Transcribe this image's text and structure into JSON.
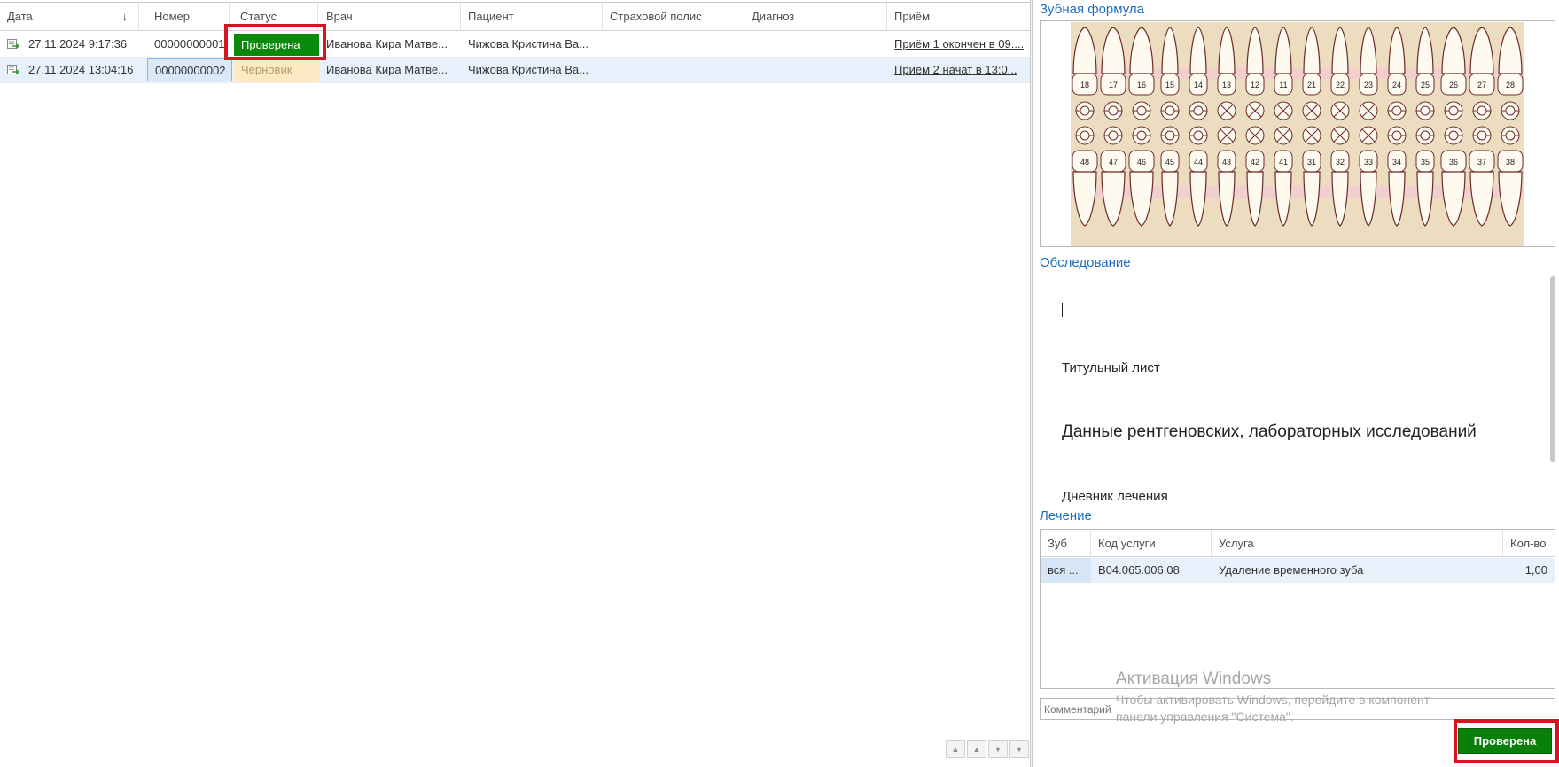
{
  "grid": {
    "columns": [
      "Дата",
      "Номер",
      "Статус",
      "Врач",
      "Пациент",
      "Страховой полис",
      "Диагноз",
      "Приём"
    ],
    "sort_indicator": "↓",
    "rows": [
      {
        "date": "27.11.2024 9:17:36",
        "number": "00000000001",
        "status": "Проверена",
        "doctor": "Иванова Кира Матве...",
        "patient": "Чижова Кристина Ва...",
        "policy": "",
        "diagnosis": "",
        "visit": "Приём 1 окончен в 09...."
      },
      {
        "date": "27.11.2024 13:04:16",
        "number": "00000000002",
        "status": "Черновик",
        "doctor": "Иванова Кира Матве...",
        "patient": "Чижова Кристина Ва...",
        "policy": "",
        "diagnosis": "",
        "visit": "Приём 2 начат в 13:0..."
      }
    ]
  },
  "right": {
    "dental_formula_title": "Зубная формула",
    "upper_teeth": [
      "18",
      "17",
      "16",
      "15",
      "14",
      "13",
      "12",
      "11",
      "21",
      "22",
      "23",
      "24",
      "25",
      "26",
      "27",
      "28"
    ],
    "lower_teeth": [
      "48",
      "47",
      "46",
      "45",
      "44",
      "43",
      "42",
      "41",
      "31",
      "32",
      "33",
      "34",
      "35",
      "36",
      "37",
      "38"
    ],
    "exam_title": "Обследование",
    "exam_lines": [
      "Титульный лист",
      "Данные рентгеновских, лабораторных исследований",
      "Дневник лечения"
    ],
    "treatment_title": "Лечение",
    "treatment_columns": [
      "Зуб",
      "Код услуги",
      "Услуга",
      "Кол-во"
    ],
    "treatment_rows": [
      {
        "tooth": "вся ...",
        "code": "B04.065.006.08",
        "service": "Удаление временного зуба",
        "qty": "1,00"
      }
    ],
    "comment_placeholder": "Комментарий",
    "watermark_title": "Активация Windows",
    "watermark_text": "Чтобы активировать Windows, перейдите в компонент панели управления \"Система\".",
    "status_button": "Проверена"
  },
  "colors": {
    "status_ok": "#0a8a0a",
    "status_draft_bg": "#fde9c4",
    "highlight_red": "#d7141f",
    "accent_blue": "#1d6dbf"
  }
}
